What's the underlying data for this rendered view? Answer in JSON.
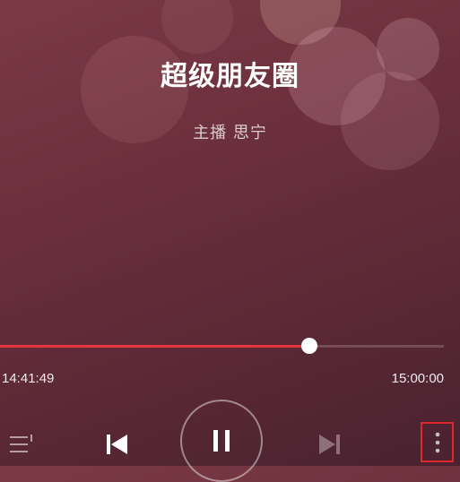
{
  "player": {
    "title": "超级朋友圈",
    "host": "主播 思宁",
    "progress_fraction": 0.697,
    "elapsed": "14:41:49",
    "duration": "15:00:00"
  },
  "controls": {
    "playlist_icon": "playlist-icon",
    "previous_icon": "skip-previous-icon",
    "pause_icon": "pause-icon",
    "next_icon": "skip-next-icon",
    "more_icon": "more-vertical-icon"
  },
  "colors": {
    "background": "#6a2f3b",
    "accent": "#e5363f",
    "highlight_box": "#e0262f"
  }
}
